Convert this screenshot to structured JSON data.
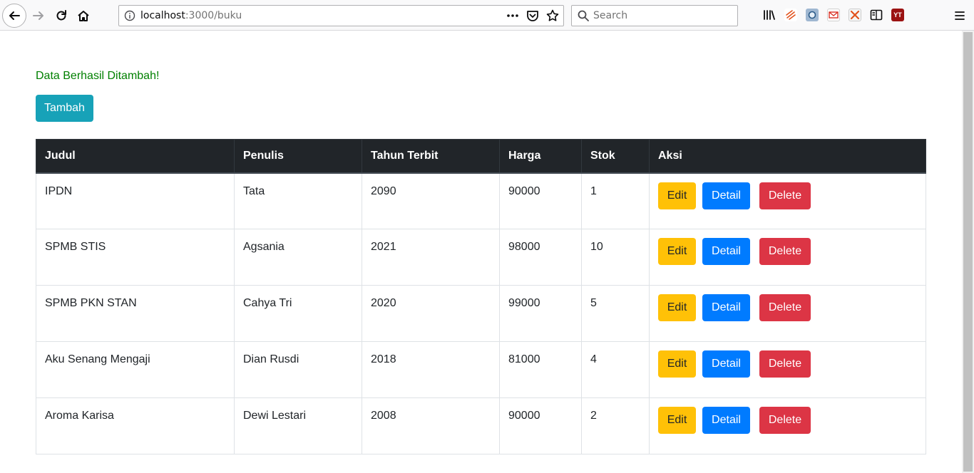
{
  "browser": {
    "url_host": "localhost",
    "url_path": ":3000/buku",
    "search_placeholder": "Search"
  },
  "page": {
    "flash_message": "Data Berhasil Ditambah!",
    "add_label": "Tambah"
  },
  "table": {
    "headers": [
      "Judul",
      "Penulis",
      "Tahun Terbit",
      "Harga",
      "Stok",
      "Aksi"
    ],
    "rows": [
      {
        "judul": "IPDN",
        "penulis": "Tata",
        "tahun": "2090",
        "harga": "90000",
        "stok": "1"
      },
      {
        "judul": "SPMB STIS",
        "penulis": "Agsania",
        "tahun": "2021",
        "harga": "98000",
        "stok": "10"
      },
      {
        "judul": "SPMB PKN STAN",
        "penulis": "Cahya Tri",
        "tahun": "2020",
        "harga": "99000",
        "stok": "5"
      },
      {
        "judul": "Aku Senang Mengaji",
        "penulis": "Dian Rusdi",
        "tahun": "2018",
        "harga": "81000",
        "stok": "4"
      },
      {
        "judul": "Aroma Karisa",
        "penulis": "Dewi Lestari",
        "tahun": "2008",
        "harga": "90000",
        "stok": "2"
      }
    ],
    "actions": {
      "edit": "Edit",
      "detail": "Detail",
      "delete": "Delete"
    }
  },
  "colors": {
    "flash": "#008000",
    "add": "#17a2b8",
    "header_bg": "#212529",
    "edit": "#ffc107",
    "detail": "#007bff",
    "delete": "#dc3545"
  }
}
